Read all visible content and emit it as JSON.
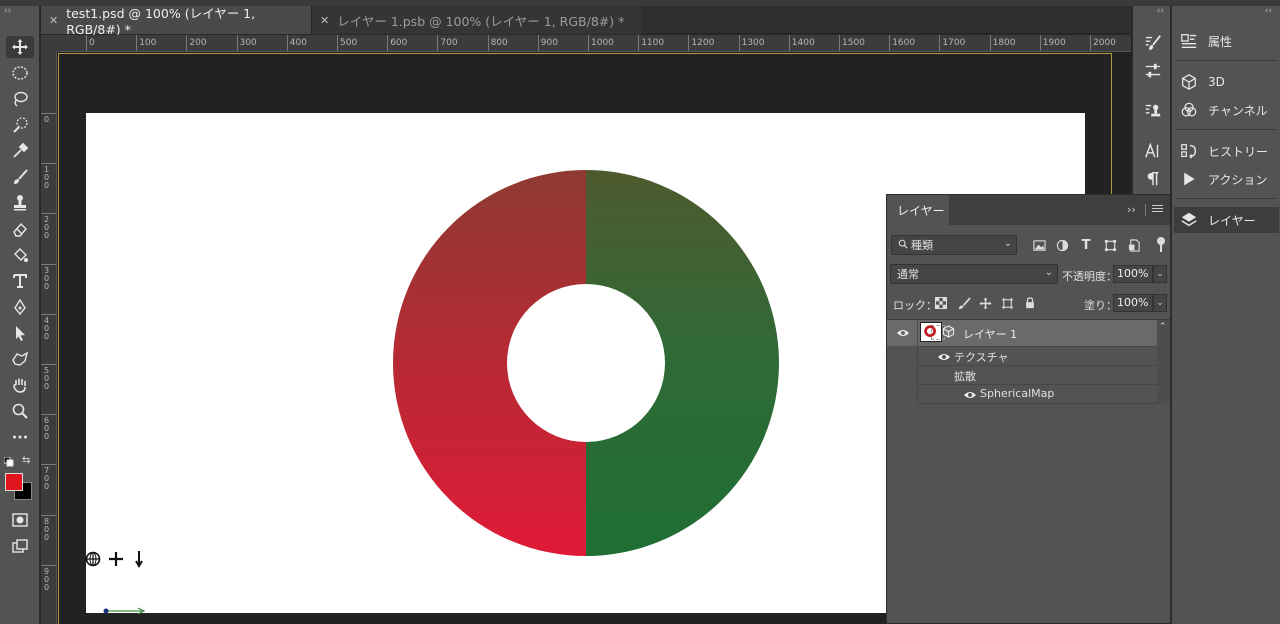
{
  "tabs": [
    {
      "label": "test1.psd @ 100% (レイヤー 1, RGB/8#) *",
      "active": true
    },
    {
      "label": "レイヤー 1.psb @ 100% (レイヤー 1, RGB/8#) *",
      "active": false
    }
  ],
  "ruler": {
    "top_labels": [
      "0",
      "100",
      "200",
      "300",
      "400",
      "500",
      "600",
      "700",
      "800",
      "900",
      "1000",
      "1100",
      "1200",
      "1300",
      "1400",
      "1500",
      "1600",
      "1700",
      "1800",
      "1900",
      "2000"
    ],
    "left_labels": [
      "0",
      "100",
      "200",
      "300",
      "400",
      "500",
      "600",
      "700",
      "800",
      "900"
    ]
  },
  "toolbar": {
    "collapse": "››",
    "tools": [
      "move-tool",
      "marquee-tool",
      "lasso-tool",
      "quick-select-tool",
      "eyedropper-tool",
      "brush-tool",
      "stamp-tool",
      "eraser-tool",
      "paint-bucket-tool",
      "type-tool",
      "pen-tool",
      "path-select-tool",
      "shape-tool",
      "hand-tool",
      "zoom-tool",
      "more-tools"
    ],
    "foreground_color": "#e0141c",
    "background_color": "#000000"
  },
  "canvas": {
    "donut": {
      "top_left_color": "#8e3a32",
      "top_right_color": "#4e5a2e",
      "right_color": "#2e6a36",
      "bottom_left_color": "#e01a36",
      "bottom_right_color": "#1f6e34"
    }
  },
  "icon_column": {
    "collapse": "‹‹"
  },
  "panel_list": {
    "collapse": "‹‹",
    "items": [
      {
        "label": "属性",
        "icon": "properties-icon"
      },
      {
        "label": "3D",
        "icon": "3d-cube-icon"
      },
      {
        "label": "チャンネル",
        "icon": "channels-icon"
      },
      {
        "label": "ヒストリー",
        "icon": "history-icon"
      },
      {
        "label": "アクション",
        "icon": "play-icon"
      },
      {
        "label": "レイヤー",
        "icon": "layers-icon",
        "active": true
      }
    ]
  },
  "layers_panel": {
    "tab": "レイヤー",
    "collapse": "››",
    "filter_kind": "種類",
    "blend_mode": "通常",
    "opacity_label": "不透明度：",
    "opacity_value": "100%",
    "lock_label": "ロック：",
    "fill_label": "塗り：",
    "fill_value": "100%",
    "layer_name": "レイヤー 1",
    "sub_texture": "テクスチャ",
    "sub_diffuse": "拡散",
    "sub_map": "SphericalMap"
  }
}
